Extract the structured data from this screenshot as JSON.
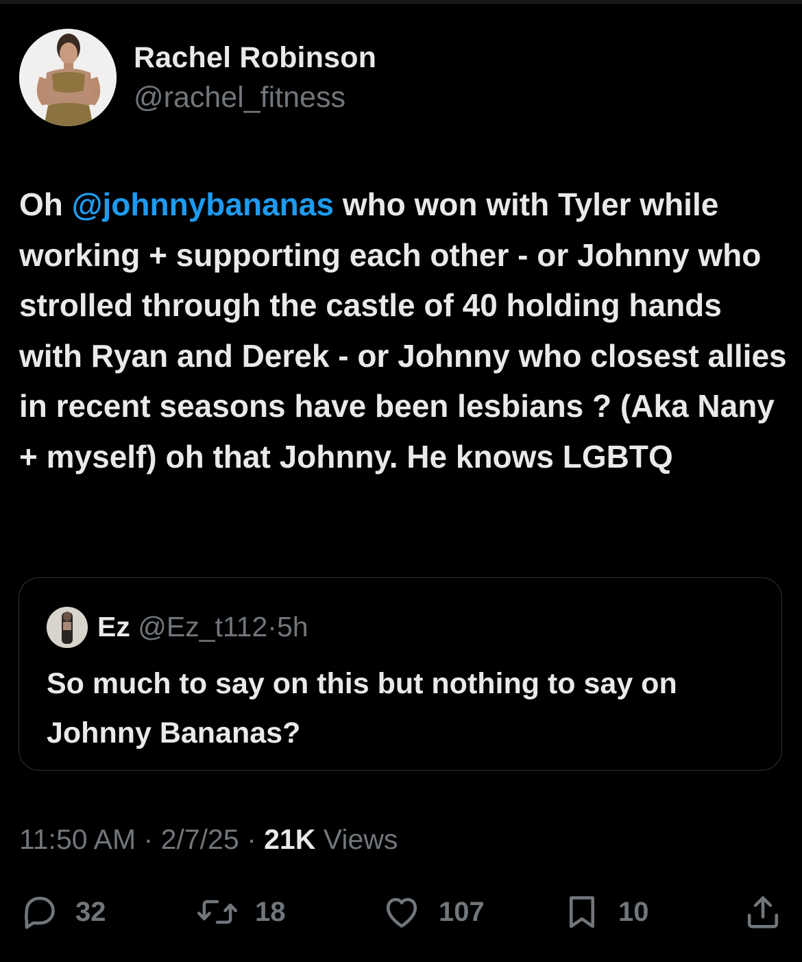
{
  "tweet": {
    "author": {
      "display_name": "Rachel Robinson",
      "handle": "@rachel_fitness"
    },
    "text": {
      "prefix": "Oh ",
      "mention": "@johnnybananas",
      "body": " who won with Tyler while working + supporting each other - or Johnny who strolled through the castle of 40 holding hands with Ryan and Derek - or Johnny who closest allies in recent seasons have been lesbians ? (Aka Nany + myself) oh that Johnny. He knows LGBTQ"
    },
    "quoted": {
      "display_name": "Ez",
      "handle": "@Ez_t112",
      "separator": "·",
      "time": "5h",
      "text": "So much to say on this but nothing to say on Johnny Bananas?"
    },
    "meta": {
      "time": "11:50 AM",
      "separator": "·",
      "date": "2/7/25",
      "views_count": "21K",
      "views_label": "Views"
    },
    "actions": {
      "reply_icon": "reply-icon",
      "reply_count": "32",
      "retweet_icon": "retweet-icon",
      "retweet_count": "18",
      "like_icon": "heart-icon",
      "like_count": "107",
      "bookmark_icon": "bookmark-icon",
      "bookmark_count": "10",
      "share_icon": "share-icon"
    }
  },
  "colors": {
    "background": "#000000",
    "text": "#e7e9ea",
    "secondary": "#71767b",
    "link": "#1d9bf0",
    "border": "#2f3336"
  }
}
